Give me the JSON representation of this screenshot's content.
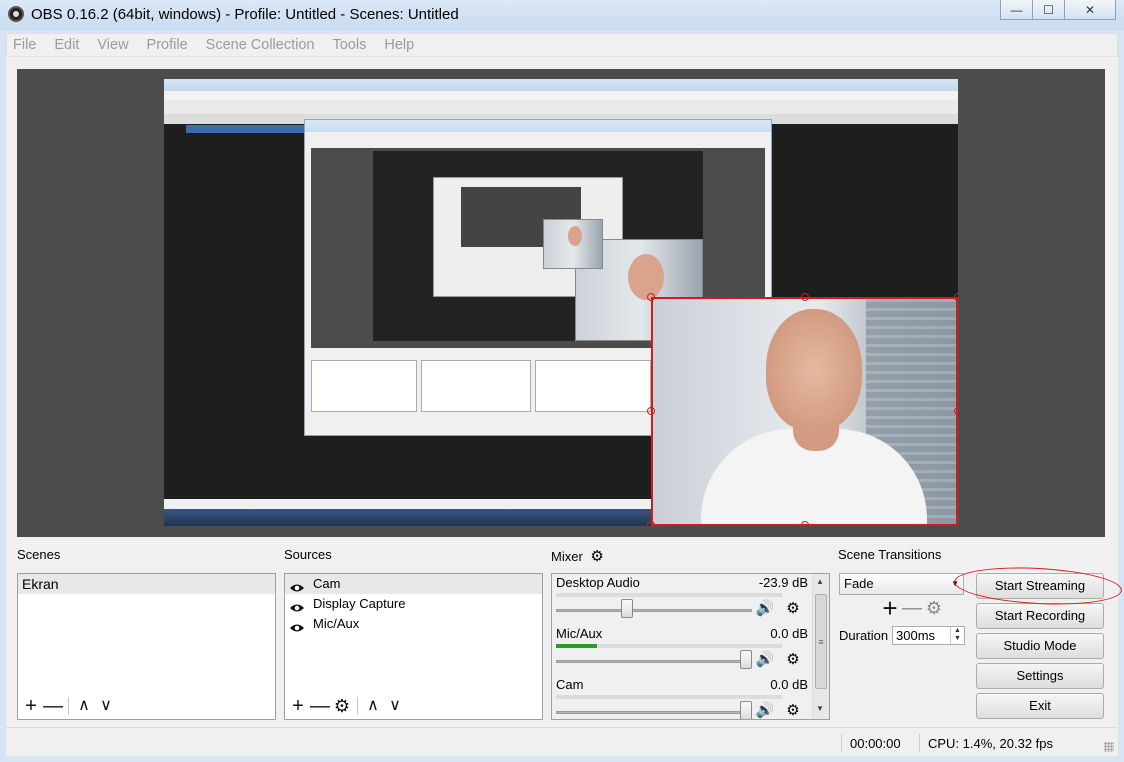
{
  "window": {
    "title": "OBS 0.16.2 (64bit, windows) - Profile: Untitled - Scenes: Untitled",
    "controls": {
      "minimize": "—",
      "maximize": "☐",
      "close": "✕"
    }
  },
  "menu": [
    "File",
    "Edit",
    "View",
    "Profile",
    "Scene Collection",
    "Tools",
    "Help"
  ],
  "scenes": {
    "title": "Scenes",
    "items": [
      {
        "label": "Ekran",
        "selected": true
      }
    ],
    "tools": [
      "+",
      "—",
      "∧",
      "∨"
    ]
  },
  "sources": {
    "title": "Sources",
    "items": [
      {
        "label": "Cam",
        "visible": true
      },
      {
        "label": "Display Capture",
        "visible": true
      },
      {
        "label": "Mic/Aux",
        "visible": true
      }
    ],
    "tools": [
      "+",
      "—",
      "⚙",
      "∧",
      "∨"
    ]
  },
  "mixer": {
    "title": "Mixer",
    "channels": [
      {
        "name": "Desktop Audio",
        "db": "-23.9 dB",
        "volume": 0.36,
        "level": 0.0
      },
      {
        "name": "Mic/Aux",
        "db": "0.0 dB",
        "volume": 0.97,
        "level": 0.18
      },
      {
        "name": "Cam",
        "db": "0.0 dB",
        "volume": 0.97,
        "level": 0.0
      }
    ]
  },
  "transitions": {
    "title": "Scene Transitions",
    "selected": "Fade",
    "duration_label": "Duration",
    "duration_value": "300ms"
  },
  "controls": {
    "start_streaming": "Start Streaming",
    "start_recording": "Start Recording",
    "studio_mode": "Studio Mode",
    "settings": "Settings",
    "exit": "Exit"
  },
  "status": {
    "time": "00:00:00",
    "cpu": "CPU: 1.4%, 20.32 fps"
  },
  "colors": {
    "annotation": "#e0191e",
    "selection_handle": "#d01c1c",
    "meter_level": "#2a9b2a"
  }
}
